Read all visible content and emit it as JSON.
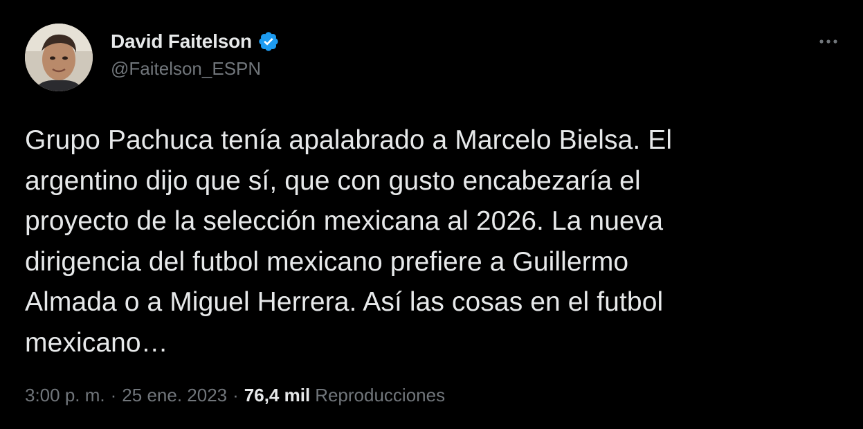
{
  "author": {
    "display_name": "David Faitelson",
    "handle": "@Faitelson_ESPN",
    "verified": true
  },
  "tweet": {
    "text": "Grupo Pachuca tenía apalabrado a Marcelo Bielsa. El\nargentino dijo que sí, que con gusto encabezaría el\nproyecto de la selección mexicana al 2026.  La nueva\ndirigencia del futbol mexicano prefiere a Guillermo\nAlmada o a Miguel Herrera. Así las cosas en el futbol\nmexicano…"
  },
  "meta": {
    "time": "3:00 p. m.",
    "separator": "·",
    "date": "25 ene. 2023",
    "views_count": "76,4 mil",
    "views_label": "Reproducciones"
  },
  "colors": {
    "background": "#000000",
    "text_primary": "#e7e9ea",
    "text_secondary": "#71767b",
    "verified_badge": "#1d9bf0"
  },
  "icons": {
    "verified": "verified-badge-icon",
    "more": "more-dots-icon"
  }
}
